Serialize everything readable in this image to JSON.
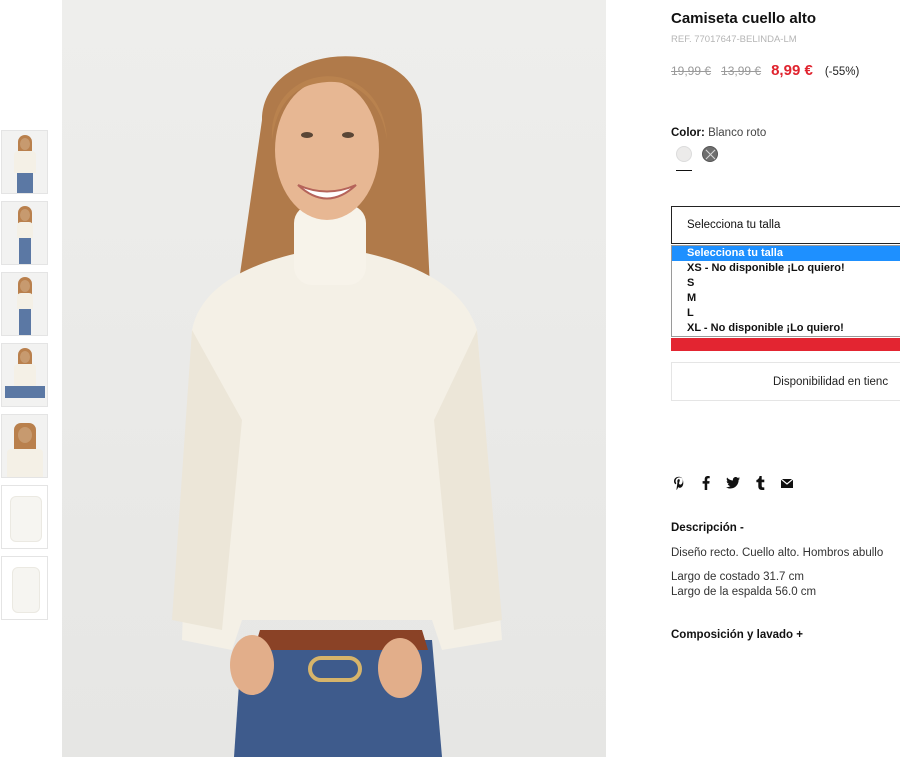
{
  "product": {
    "title": "Camiseta cuello alto",
    "ref": "REF. 77017647-BELINDA-LM",
    "price_original": "19,99 €",
    "price_previous": "13,99 €",
    "price_current": "8,99 €",
    "discount": "(-55%)"
  },
  "color": {
    "label": "Color:",
    "value": "Blanco roto",
    "swatches": [
      "#ecebea",
      "#6e6e6e"
    ]
  },
  "size": {
    "select_label": "Selecciona tu talla",
    "options": [
      "Selecciona tu talla",
      "XS - No disponible ¡Lo quiero!",
      "S",
      "M",
      "L",
      "XL - No disponible ¡Lo quiero!"
    ],
    "selected_index": 0
  },
  "availability_label": "Disponibilidad en tienc",
  "share_icons": [
    "pinterest-icon",
    "facebook-icon",
    "twitter-icon",
    "tumblr-icon",
    "mail-icon"
  ],
  "description": {
    "heading": "Descripción  -",
    "text": "Diseño recto. Cuello alto. Hombros abullo",
    "measure_1": "Largo de costado 31.7 cm",
    "measure_2": "Largo de la espalda 56.0 cm"
  },
  "composition_heading": "Composición y lavado  +",
  "colors": {
    "accent": "#e0232e",
    "select_highlight": "#1e90ff",
    "cta": "#e32531"
  }
}
